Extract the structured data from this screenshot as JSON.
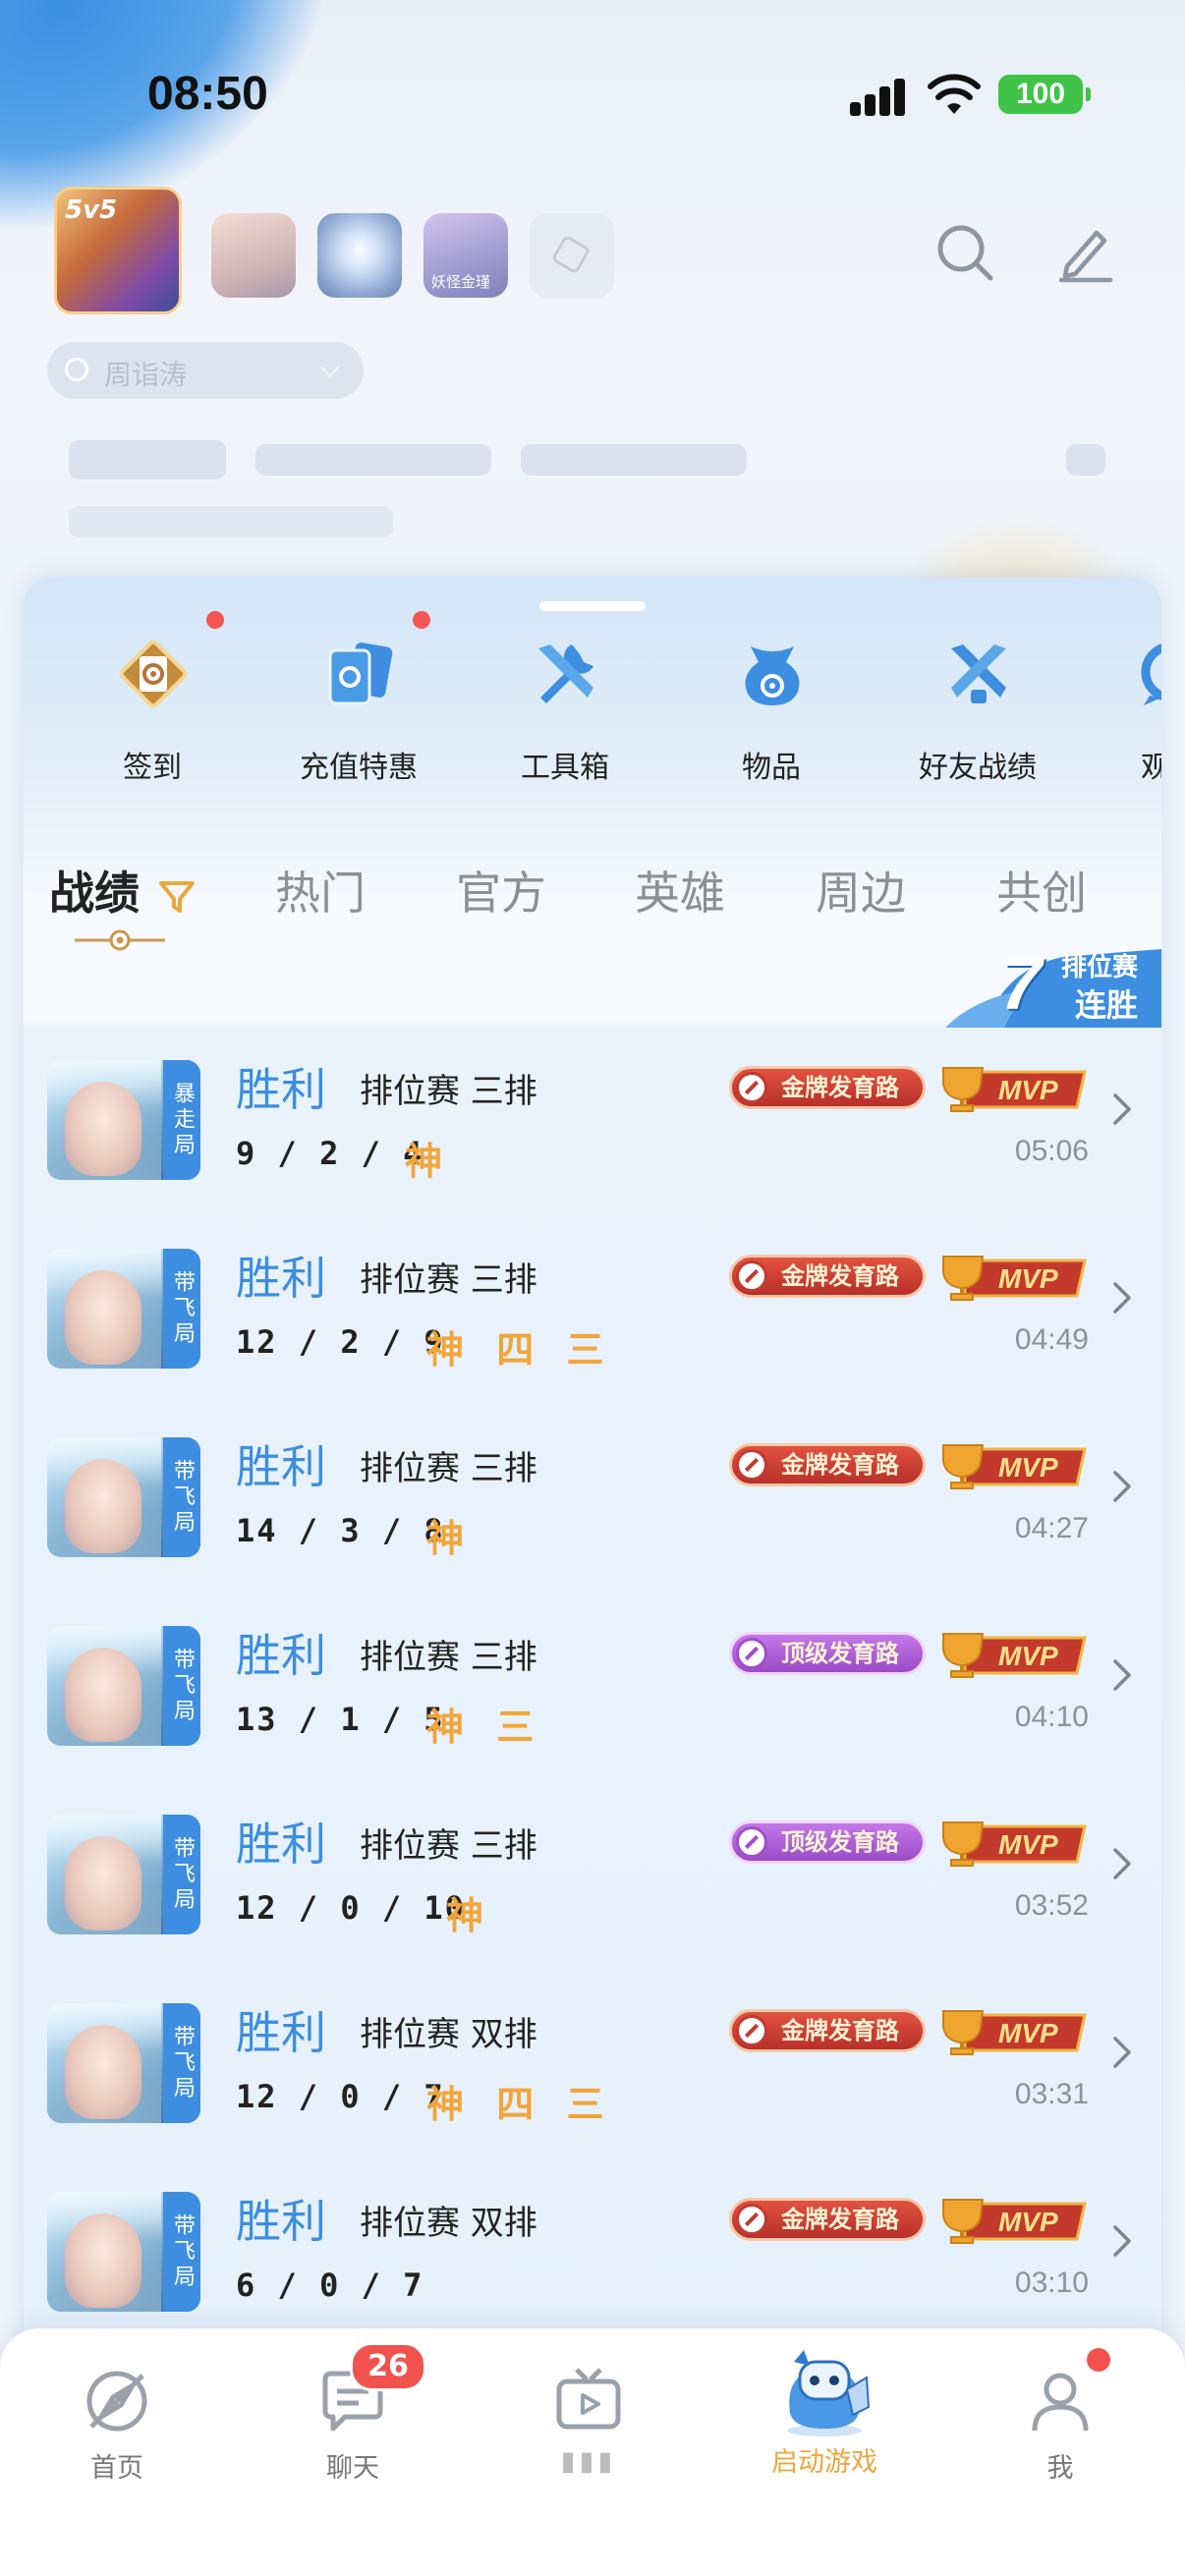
{
  "status_bar": {
    "time": "08:50",
    "battery": "100"
  },
  "games": {
    "main_label": "5v5",
    "small_3_label": "妖怪金瑾"
  },
  "role_selector": {
    "name": "周诣涛"
  },
  "quick_actions": [
    {
      "label": "签到",
      "icon": "sign-in-card-icon",
      "badge": true
    },
    {
      "label": "充值特惠",
      "icon": "recharge-cards-icon",
      "badge": true
    },
    {
      "label": "工具箱",
      "icon": "toolbox-icon",
      "badge": false
    },
    {
      "label": "物品",
      "icon": "item-bag-icon",
      "badge": false
    },
    {
      "label": "好友战绩",
      "icon": "friend-record-icon",
      "badge": false
    },
    {
      "label": "观战",
      "icon": "spectate-icon",
      "badge": false
    }
  ],
  "tabs": [
    {
      "label": "战绩",
      "active": true
    },
    {
      "label": "热门",
      "active": false
    },
    {
      "label": "官方",
      "active": false
    },
    {
      "label": "英雄",
      "active": false
    },
    {
      "label": "周边",
      "active": false
    },
    {
      "label": "共创",
      "active": false
    }
  ],
  "streak": {
    "number": "7",
    "line1": "排位赛",
    "line2": "连胜"
  },
  "matches": [
    {
      "tag": "暴走局",
      "result": "胜利",
      "mode": "排位赛 三排",
      "kda": "9 / 2 / 4",
      "marks": "神",
      "role_badge": "金牌发育路",
      "role_color": "red",
      "mvp": "MVP",
      "time": "05:06"
    },
    {
      "tag": "带飞局",
      "result": "胜利",
      "mode": "排位赛 三排",
      "kda": "12 / 2 / 9",
      "marks": "神 四 三",
      "role_badge": "金牌发育路",
      "role_color": "red",
      "mvp": "MVP",
      "time": "04:49"
    },
    {
      "tag": "带飞局",
      "result": "胜利",
      "mode": "排位赛 三排",
      "kda": "14 / 3 / 8",
      "marks": "神",
      "role_badge": "金牌发育路",
      "role_color": "red",
      "mvp": "MVP",
      "time": "04:27"
    },
    {
      "tag": "带飞局",
      "result": "胜利",
      "mode": "排位赛 三排",
      "kda": "13 / 1 / 5",
      "marks": "神 三",
      "role_badge": "顶级发育路",
      "role_color": "purple",
      "mvp": "MVP",
      "time": "04:10"
    },
    {
      "tag": "带飞局",
      "result": "胜利",
      "mode": "排位赛 三排",
      "kda": "12 / 0 / 10",
      "marks": "神",
      "role_badge": "顶级发育路",
      "role_color": "purple",
      "mvp": "MVP",
      "time": "03:52"
    },
    {
      "tag": "带飞局",
      "result": "胜利",
      "mode": "排位赛 双排",
      "kda": "12 / 0 / 7",
      "marks": "神 四 三",
      "role_badge": "金牌发育路",
      "role_color": "red",
      "mvp": "MVP",
      "time": "03:31"
    },
    {
      "tag": "带飞局",
      "result": "胜利",
      "mode": "排位赛 双排",
      "kda": "6 / 0 / 7",
      "marks": "",
      "role_badge": "金牌发育路",
      "role_color": "red",
      "mvp": "MVP",
      "time": "03:10"
    }
  ],
  "bottom_nav": [
    {
      "label": "首页",
      "icon": "compass-icon",
      "active": false
    },
    {
      "label": "聊天",
      "icon": "chat-icon",
      "active": false,
      "badge": "26"
    },
    {
      "label": "",
      "icon": "tv-icon",
      "active": false
    },
    {
      "label": "启动游戏",
      "icon": "robot-mascot-icon",
      "active": true
    },
    {
      "label": "我",
      "icon": "profile-icon",
      "active": false,
      "dot": true
    }
  ],
  "colors": {
    "accent_blue": "#3c8ee0",
    "orange": "#f0a53c",
    "badge_red": "#f1524e"
  }
}
